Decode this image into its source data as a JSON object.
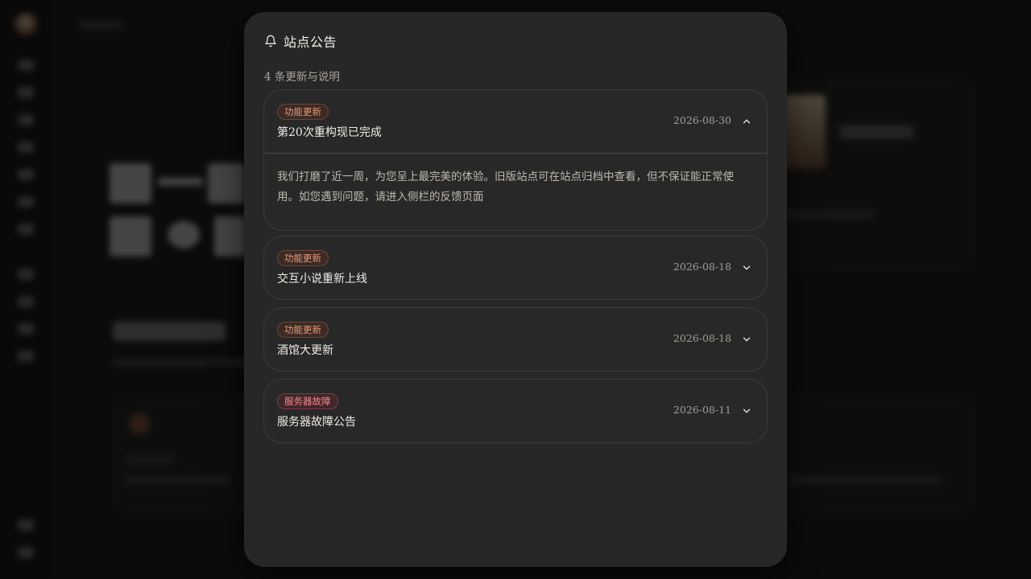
{
  "modal": {
    "title": "站点公告",
    "subtitle": "4 条更新与说明",
    "icon": "bell-icon"
  },
  "announcements": [
    {
      "tag": "功能更新",
      "tag_type": "feature",
      "title": "第20次重构现已完成",
      "date": "2026-08-30",
      "expanded": true,
      "body": "我们打磨了近一周，为您呈上最完美的体验。旧版站点可在站点归档中查看，但不保证能正常使用。如您遇到问题，请进入侧栏的反馈页面"
    },
    {
      "tag": "功能更新",
      "tag_type": "feature",
      "title": "交互小说重新上线",
      "date": "2026-08-18",
      "expanded": false
    },
    {
      "tag": "功能更新",
      "tag_type": "feature",
      "title": "酒馆大更新",
      "date": "2026-08-18",
      "expanded": false
    },
    {
      "tag": "服务器故障",
      "tag_type": "fault",
      "title": "服务器故障公告",
      "date": "2026-08-11",
      "expanded": false
    }
  ],
  "colors": {
    "modal_bg": "#272727",
    "feature_tag": "#e39a7a",
    "fault_tag": "#ef8b93"
  }
}
